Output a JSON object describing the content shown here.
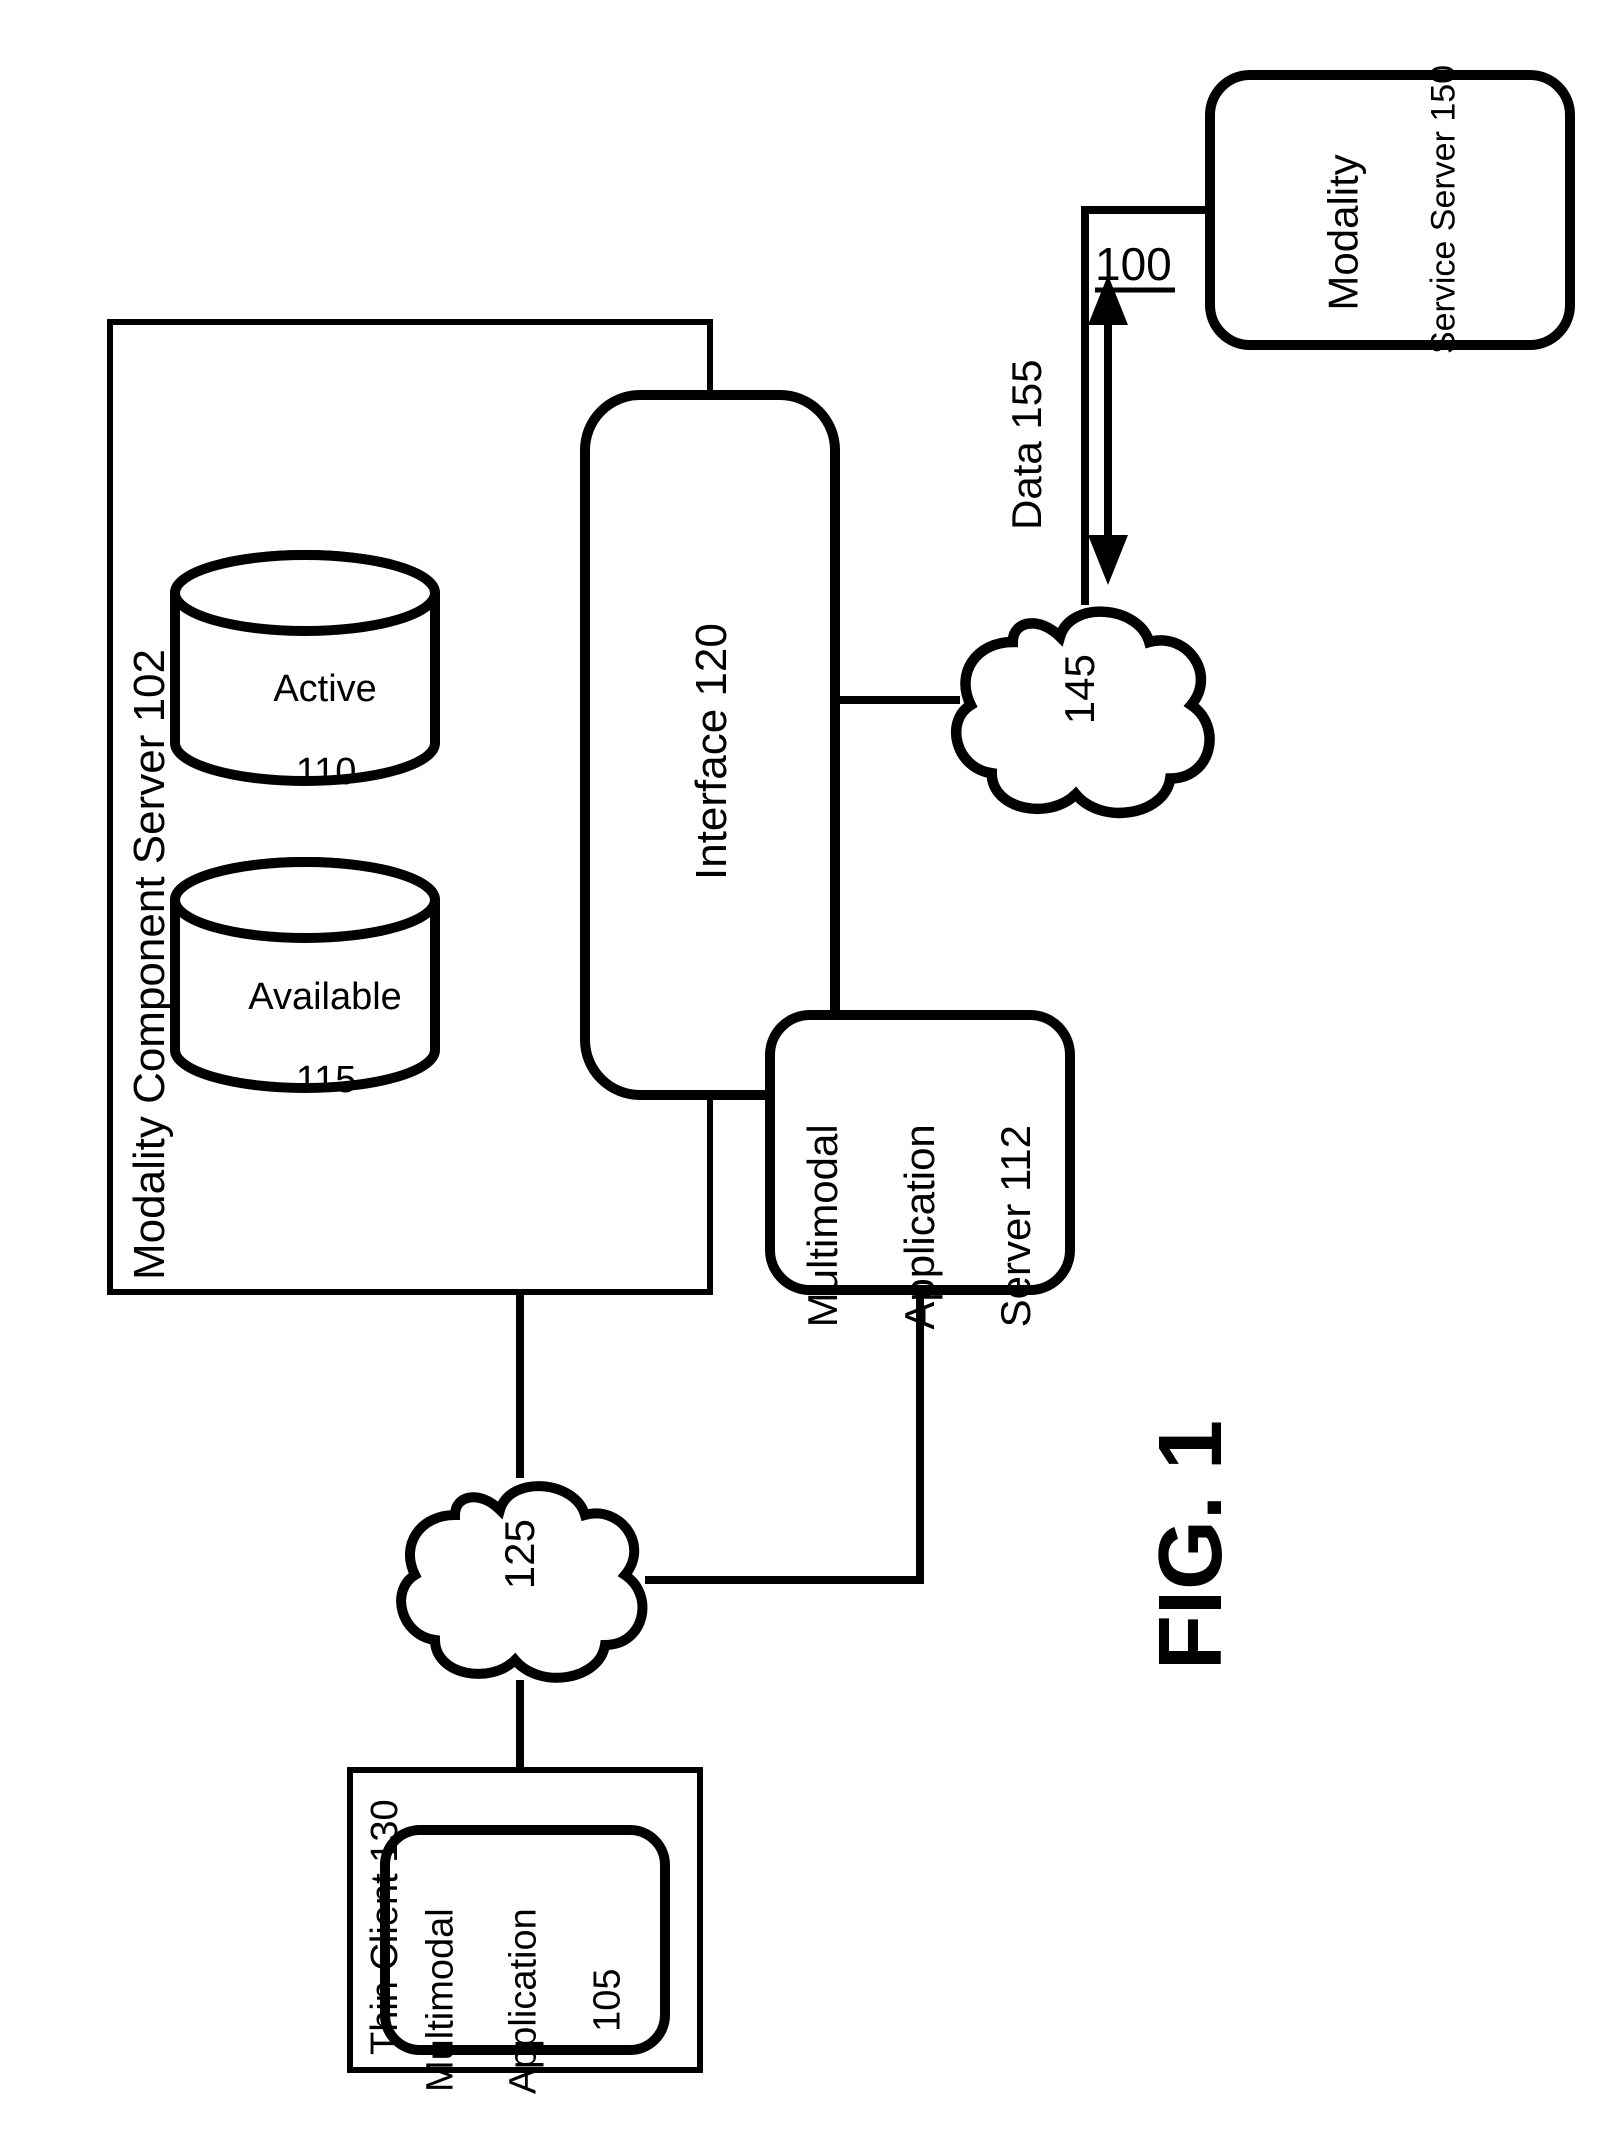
{
  "figure": {
    "number_label": "100",
    "caption": "FIG. 1"
  },
  "modality_component_server": {
    "title": "Modality Component Server 102",
    "active": {
      "l1": "Active",
      "l2": "110"
    },
    "available": {
      "l1": "Available",
      "l2": "115"
    },
    "interface": "Interface 120"
  },
  "clouds": {
    "c125": "125",
    "c145": "145"
  },
  "data_label": "Data 155",
  "modality_service_server": {
    "l1": "Modality",
    "l2": "Service Server 150"
  },
  "multimodal_app_server": {
    "l1": "Multimodal",
    "l2": "Application",
    "l3": "Server 112"
  },
  "thin_client": {
    "title": "Thin Client 130",
    "app": {
      "l1": "Multimodal",
      "l2": "Application",
      "l3": "105"
    }
  }
}
